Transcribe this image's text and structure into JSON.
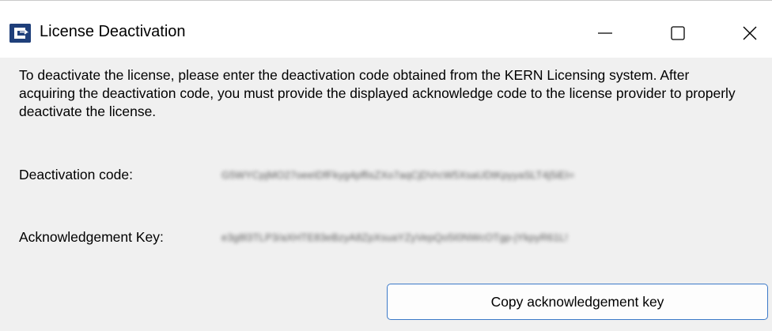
{
  "window": {
    "title": "License Deactivation",
    "icon": "kern-app-icon",
    "controls": {
      "minimize_icon": "minimize-icon",
      "maximize_icon": "maximize-icon",
      "close_icon": "close-icon"
    }
  },
  "content": {
    "description": "To deactivate the license, please enter the deactivation code obtained from the KERN Licensing system. After acquiring the deactivation code, you must provide the displayed acknowledge code to the license provider to properly deactivate the license.",
    "deactivation_label": "Deactivation code:",
    "deactivation_value": "G5WYCpjMO27oeeIDfFkyg4pffisZXo7aqCjDVrcW5XsaUDtKpyyaSLT4j5iEI=",
    "acknowledgement_label": "Acknowledgement Key:",
    "acknowledgement_value": "e3g8l3TLP3/aXHTE83eBzyA8ZpXsuaYZyVepQo5I0NWcOTgp-jYkpyR61L!",
    "copy_button_label": "Copy acknowledgement key"
  },
  "colors": {
    "accent": "#3b79c8",
    "app_icon": "#1f3f7a",
    "window_bg": "#f0f0f0",
    "titlebar_bg": "#ffffff"
  }
}
